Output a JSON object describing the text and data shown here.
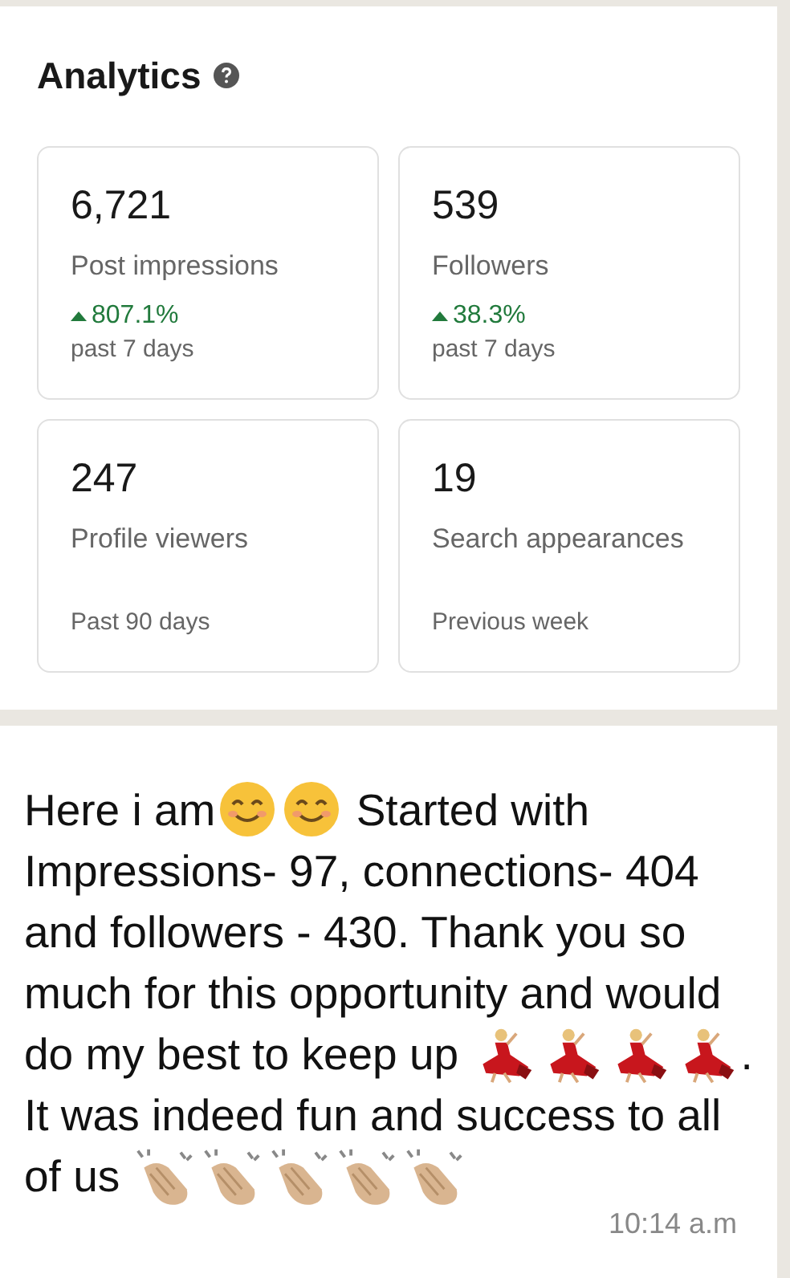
{
  "analytics": {
    "title": "Analytics",
    "cards": [
      {
        "value": "6,721",
        "label": "Post impressions",
        "change": "807.1%",
        "period": "past 7 days"
      },
      {
        "value": "539",
        "label": "Followers",
        "change": "38.3%",
        "period": "past 7 days"
      },
      {
        "value": "247",
        "label": "Profile viewers",
        "period": "Past 90 days"
      },
      {
        "value": "19",
        "label": "Search appearances",
        "period": "Previous week"
      }
    ]
  },
  "message": {
    "parts": [
      {
        "kind": "text",
        "text": "Here i am"
      },
      {
        "kind": "smile"
      },
      {
        "kind": "smile"
      },
      {
        "kind": "text",
        "text": " Started with Impressions- 97, connections- 404 and followers - 430. Thank you so much for this opportunity and would do my best to keep up "
      },
      {
        "kind": "dancer"
      },
      {
        "kind": "dancer"
      },
      {
        "kind": "dancer"
      },
      {
        "kind": "dancer"
      },
      {
        "kind": "text",
        "text": ". It was indeed fun and success to all of us "
      },
      {
        "kind": "clap"
      },
      {
        "kind": "clap"
      },
      {
        "kind": "clap"
      },
      {
        "kind": "clap"
      },
      {
        "kind": "clap"
      }
    ],
    "time": "10:14 a.m"
  }
}
